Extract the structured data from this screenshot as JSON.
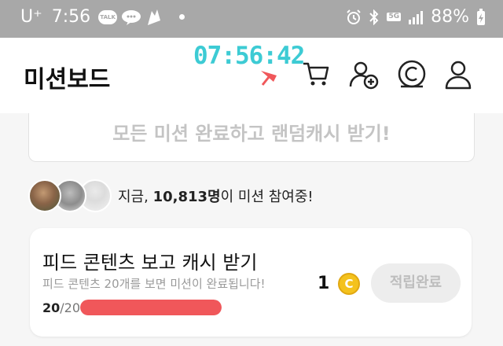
{
  "status_bar": {
    "carrier": "U⁺",
    "time": "7:56",
    "talk_icon_text": "TALK",
    "network": "5G",
    "battery": "88%"
  },
  "header": {
    "title": "미션보드",
    "clock_overlay": "07:56:42",
    "icons": [
      "cart-icon",
      "add-user-icon",
      "cash-icon",
      "profile-icon"
    ]
  },
  "banner": {
    "text": "모든 미션 완료하고 랜덤캐시 받기!"
  },
  "participants": {
    "prefix": "지금, ",
    "count": "10,813명",
    "suffix": "이 미션 참여중!"
  },
  "mission": {
    "title": "피드 콘텐츠 보고 캐시 받기",
    "description": "피드 콘텐츠 20개를 보면 미션이 완료됩니다!",
    "progress_current": "20",
    "progress_total": "/20",
    "progress_fraction": 1.0,
    "reward_amount": "1",
    "coin_symbol": "C",
    "button_label": "적립완료"
  },
  "colors": {
    "accent_clock": "#3dcbd4",
    "progress_fill": "#f0575a",
    "coin": "#f4c21d",
    "status_bar": "#a8a8a8"
  }
}
